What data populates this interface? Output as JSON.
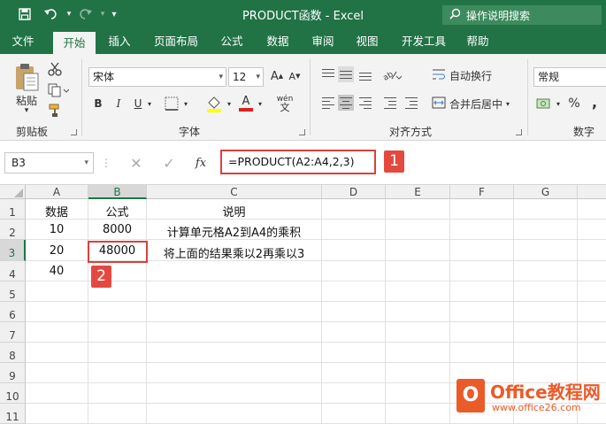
{
  "window": {
    "title": "PRODUCT函数  -  Excel",
    "tell_me": "操作说明搜索",
    "accent": "#217346"
  },
  "quick_access": [
    "save-icon",
    "undo-icon",
    "redo-icon",
    "customize-icon"
  ],
  "tabs": [
    {
      "label": "文件",
      "active": false
    },
    {
      "label": "开始",
      "active": true
    },
    {
      "label": "插入",
      "active": false
    },
    {
      "label": "页面布局",
      "active": false
    },
    {
      "label": "公式",
      "active": false
    },
    {
      "label": "数据",
      "active": false
    },
    {
      "label": "审阅",
      "active": false
    },
    {
      "label": "视图",
      "active": false
    },
    {
      "label": "开发工具",
      "active": false
    },
    {
      "label": "帮助",
      "active": false
    }
  ],
  "ribbon": {
    "clipboard": {
      "paste_label": "粘贴",
      "group_label": "剪贴板"
    },
    "font": {
      "name": "宋体",
      "size": "12",
      "bold": "B",
      "italic": "I",
      "underline": "U",
      "font_color_glyph": "A",
      "wen_glyph": "wén",
      "group_label": "字体"
    },
    "alignment": {
      "wrap_label": "自动换行",
      "merge_label": "合并后居中",
      "group_label": "对齐方式"
    },
    "number": {
      "format": "常规",
      "percent": "%",
      "comma": ",",
      "group_label": "数字"
    }
  },
  "formula_bar": {
    "name_box": "B3",
    "fx_label": "fx",
    "formula": "=PRODUCT(A2:A4,2,3)",
    "callout_1": "1"
  },
  "sheet": {
    "columns": [
      "A",
      "B",
      "C",
      "D",
      "E",
      "F",
      "G"
    ],
    "rows": [
      "1",
      "2",
      "3",
      "4",
      "5",
      "6",
      "7",
      "8",
      "9",
      "10",
      "11"
    ],
    "selected_cell": "B3",
    "callout_2": "2",
    "cells": {
      "A1": "数据",
      "B1": "公式",
      "C1": "说明",
      "A2": "10",
      "B2": "8000",
      "C2": "计算单元格A2到A4的乘积",
      "A3": "20",
      "B3": "48000",
      "C3": "将上面的结果乘以2再乘以3",
      "A4": "40"
    }
  },
  "watermark": {
    "logo_glyph": "O",
    "title": "Office教程网",
    "url": "www.office26.com"
  }
}
